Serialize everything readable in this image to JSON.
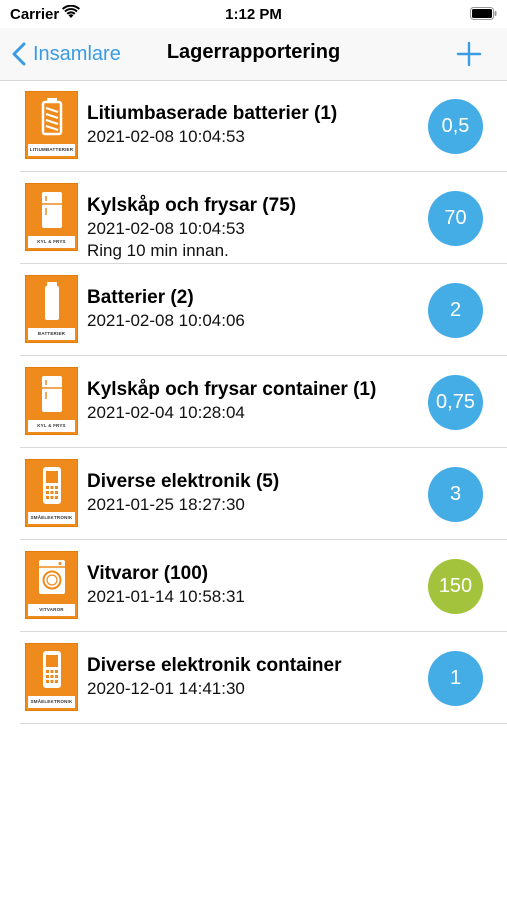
{
  "status": {
    "carrier": "Carrier",
    "time": "1:12 PM"
  },
  "nav": {
    "back_label": "Insamlare",
    "title": "Lagerrapportering"
  },
  "colors": {
    "accent": "#3a9be4",
    "badge_blue": "#45ade6",
    "badge_green": "#a2c33b",
    "icon_orange": "#ef8a1d"
  },
  "items": [
    {
      "title": "Litiumbaserade batterier (1)",
      "date": "2021-02-08 10:04:53",
      "note": "",
      "badge": "0,5",
      "badge_color": "blue",
      "icon": "lithium-battery-icon",
      "icon_caption": "LITIUMBATTERIER"
    },
    {
      "title": "Kylskåp och frysar (75)",
      "date": "2021-02-08 10:04:53",
      "note": "Ring 10 min innan.",
      "badge": "70",
      "badge_color": "blue",
      "icon": "fridge-icon",
      "icon_caption": "KYL & FRYS"
    },
    {
      "title": "Batterier (2)",
      "date": "2021-02-08 10:04:06",
      "note": "",
      "badge": "2",
      "badge_color": "blue",
      "icon": "battery-icon",
      "icon_caption": "BATTERIER"
    },
    {
      "title": "Kylskåp och frysar container (1)",
      "date": "2021-02-04 10:28:04",
      "note": "",
      "badge": "0,75",
      "badge_color": "blue",
      "icon": "fridge-icon",
      "icon_caption": "KYL & FRYS"
    },
    {
      "title": "Diverse elektronik (5)",
      "date": "2021-01-25 18:27:30",
      "note": "",
      "badge": "3",
      "badge_color": "blue",
      "icon": "phone-icon",
      "icon_caption": "SMÅELEKTRONIK"
    },
    {
      "title": "Vitvaror (100)",
      "date": "2021-01-14 10:58:31",
      "note": "",
      "badge": "150",
      "badge_color": "green",
      "icon": "washing-machine-icon",
      "icon_caption": "VITVAROR"
    },
    {
      "title": "Diverse elektronik container",
      "date": "2020-12-01 14:41:30",
      "note": "",
      "badge": "1",
      "badge_color": "blue",
      "icon": "phone-icon",
      "icon_caption": "SMÅELEKTRONIK"
    }
  ]
}
